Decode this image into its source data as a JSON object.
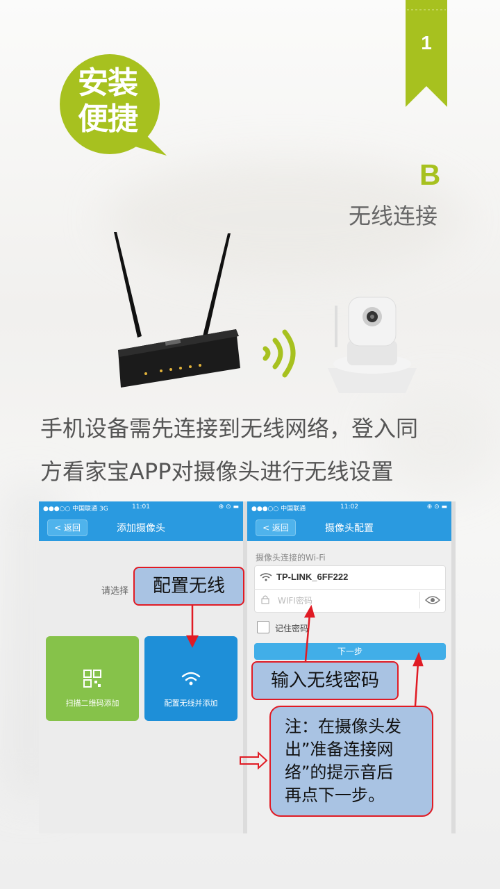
{
  "ribbon": {
    "number": "1"
  },
  "badge": {
    "line1": "安装",
    "line2": "便捷"
  },
  "section": {
    "letter": "B",
    "title": "无线连接"
  },
  "description": {
    "line1": "手机设备需先连接到无线网络，登入同",
    "line2": "方看家宝APP对摄像头进行无线设置"
  },
  "phone_left": {
    "status": {
      "carrier": "●●●○○ 中国联通  3G",
      "time": "11:01",
      "icons": "⊕ ⊙ ▬"
    },
    "back_label": "< 返回",
    "title": "添加摄像头",
    "prompt": "请选择",
    "tiles": [
      {
        "label": "扫描二维码添加",
        "icon": "qr-code-icon"
      },
      {
        "label": "配置无线并添加",
        "icon": "wifi-icon"
      }
    ]
  },
  "phone_right": {
    "status": {
      "carrier": "●●●○○ 中国联通",
      "time": "11:02",
      "icons": "⊕ ⊙ ▬"
    },
    "back_label": "< 返回",
    "title": "摄像头配置",
    "wifi_caption": "摄像头连接的Wi-Fi",
    "ssid": "TP-LINK_6FF222",
    "password_placeholder": "WIFI密码",
    "remember_label": "记住密码",
    "next_label": "下一步"
  },
  "callouts": {
    "configure": "配置无线",
    "enter_password": "输入无线密码",
    "note_lines": [
      "注：在摄像头发",
      "出”准备连接网",
      "络”的提示音后",
      "再点下一步。"
    ]
  },
  "colors": {
    "accent_green": "#a7c11f",
    "ios_blue": "#2a9ae0",
    "callout_fill": "#a9c3e3",
    "callout_border": "#e01b24"
  }
}
